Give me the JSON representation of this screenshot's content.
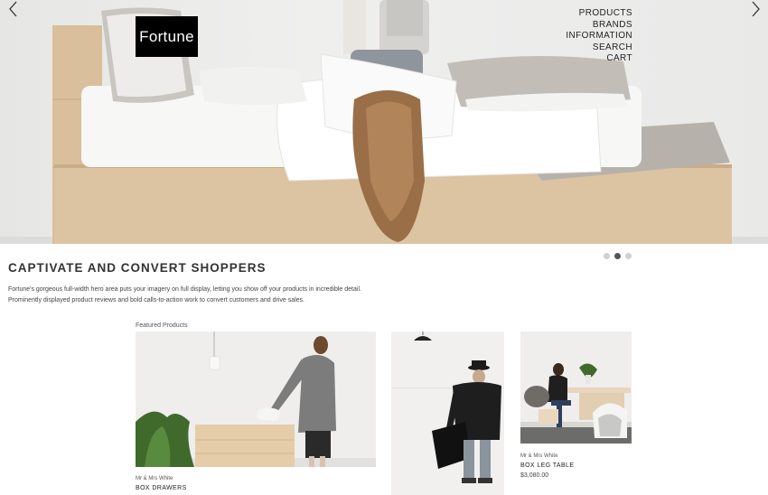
{
  "store": {
    "logo_text": "Fortune"
  },
  "nav": {
    "items": [
      "PRODUCTS",
      "BRANDS",
      "INFORMATION",
      "SEARCH",
      "CART"
    ]
  },
  "hero": {
    "prev_icon": "chevron-left-icon",
    "next_icon": "chevron-right-icon",
    "slide_count": 3,
    "active_slide": 2
  },
  "intro": {
    "heading": "CAPTIVATE AND CONVERT SHOPPERS",
    "body": "Fortune's gorgeous full-width hero area puts your imagery on full display, letting you show off your products in incredible detail. Prominently displayed product reviews and bold calls-to-action work to convert customers and drive sales."
  },
  "featured": {
    "label": "Featured Products",
    "products": [
      {
        "brand": "Mr & Mrs White",
        "name": "BOX DRAWERS",
        "price": ""
      },
      {
        "brand": "",
        "name": "",
        "price": ""
      },
      {
        "brand": "Mr & Mrs White",
        "name": "BOX LEG TABLE",
        "price": "$3,080.00"
      }
    ]
  },
  "colors": {
    "logo_bg": "#000000",
    "text": "#333333",
    "dot_active": "#555555",
    "dot_inactive": "#d0d0d0"
  }
}
